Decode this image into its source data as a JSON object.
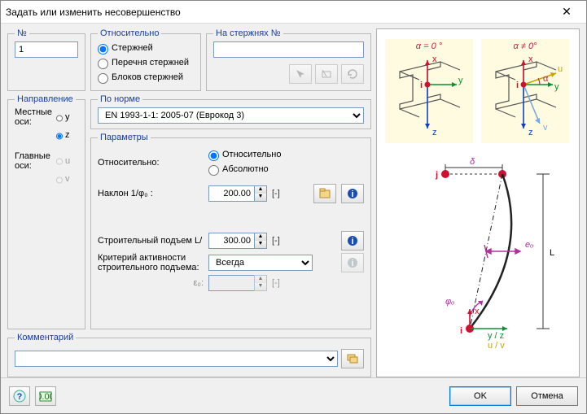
{
  "window": {
    "title": "Задать или изменить несовершенство"
  },
  "no": {
    "legend": "№",
    "value": "1"
  },
  "relative": {
    "legend": "Относительно",
    "options": {
      "members": "Стержней",
      "sets": "Перечня стержней",
      "blocks": "Блоков стержней"
    },
    "selected": "members"
  },
  "onMembers": {
    "legend": "На стержнях №",
    "value": ""
  },
  "direction": {
    "legend": "Направление",
    "local_label": "Местные оси:",
    "global_label": "Главные оси:",
    "y": "y",
    "z": "z",
    "u": "u",
    "v": "v",
    "selected": "z"
  },
  "standard": {
    "legend": "По норме",
    "value": "EN 1993-1-1: 2005-07  (Еврокод 3)"
  },
  "params": {
    "legend": "Параметры",
    "rel_label": "Относительно:",
    "rel_opt": "Относительно",
    "abs_opt": "Абсолютно",
    "rel_selected": "rel",
    "slope_label": "Наклон 1/φ₀ :",
    "slope_value": "200.00",
    "slope_unit": "[-]",
    "camber_label": "Строительный подъем L/",
    "camber_value": "300.00",
    "camber_unit": "[-]",
    "criterion_label": "Критерий активности строительного подъема:",
    "criterion_value": "Всегда",
    "eps_label": "ε₀:",
    "eps_value": "",
    "eps_unit": "[-]"
  },
  "comment": {
    "legend": "Комментарий",
    "value": ""
  },
  "footer": {
    "ok": "OK",
    "cancel": "Отмена"
  },
  "diagram": {
    "alpha0": "α = 0 °",
    "alphaN": "α ≠ 0°",
    "x": "x",
    "y": "y",
    "z": "z",
    "u": "u",
    "v": "v",
    "i": "i",
    "j": "j",
    "delta": "δ",
    "eo": "eₒ",
    "phio": "φₒ",
    "yz": "y / z",
    "uv": "u / v",
    "L": "L",
    "alpha_sym": "α"
  }
}
